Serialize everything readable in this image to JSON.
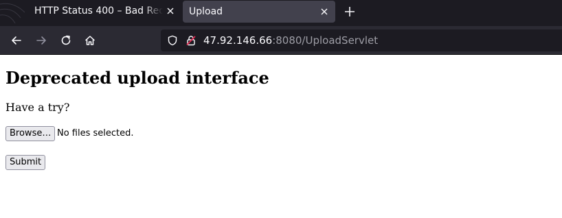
{
  "browser": {
    "tabs": [
      {
        "title": "HTTP Status 400 – Bad Request",
        "active": false
      },
      {
        "title": "Upload",
        "active": true
      }
    ],
    "url": {
      "host": "47.92.146.66",
      "rest": ":8080/UploadServlet"
    },
    "icons": {
      "back": "back-arrow-icon",
      "forward": "forward-arrow-icon",
      "reload": "reload-icon",
      "home": "home-icon",
      "shield": "shield-icon",
      "lock": "insecure-lock-icon",
      "close": "close-icon",
      "new_tab": "plus-icon"
    },
    "colors": {
      "tabstrip_bg": "#1c1b22",
      "active_tab_bg": "#42414d",
      "navbar_bg": "#2b2a33",
      "insecure_accent": "#e22850"
    }
  },
  "page": {
    "title": "Deprecated upload interface",
    "prompt": "Have a try?",
    "browse_label": "Browse…",
    "file_status": "No files selected.",
    "submit_label": "Submit"
  }
}
